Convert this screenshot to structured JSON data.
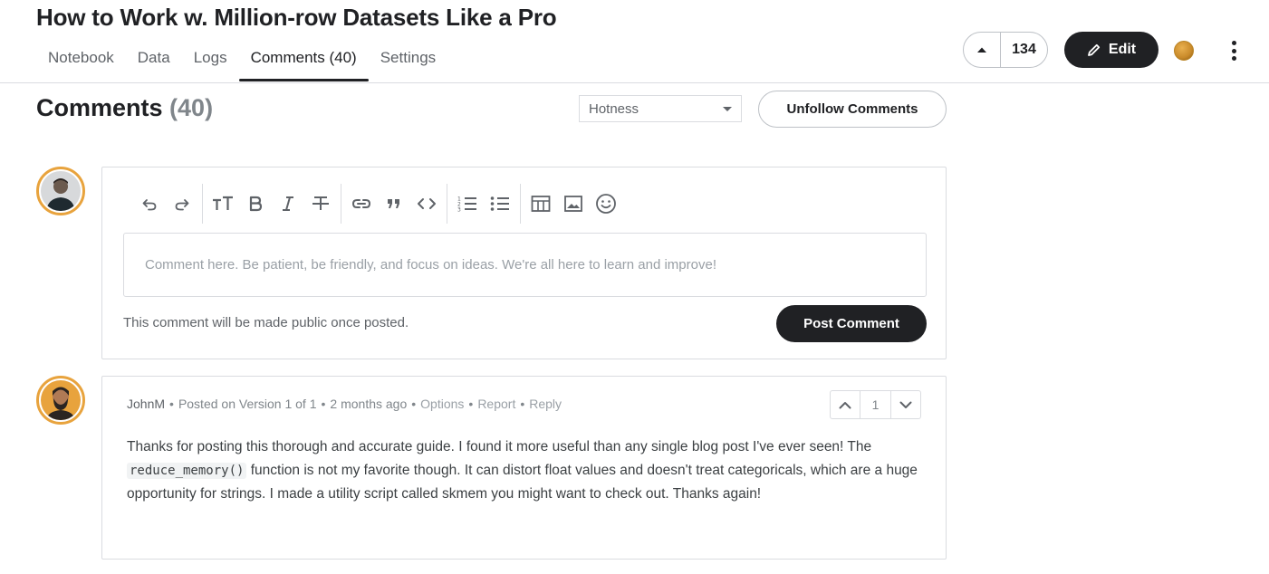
{
  "page": {
    "title": "How to Work w. Million-row Datasets Like a Pro"
  },
  "tabs": [
    {
      "label": "Notebook"
    },
    {
      "label": "Data"
    },
    {
      "label": "Logs"
    },
    {
      "label": "Comments (40)",
      "active": true
    },
    {
      "label": "Settings"
    }
  ],
  "header": {
    "vote_count": "134",
    "edit_label": "Edit"
  },
  "comments_section": {
    "heading": "Comments",
    "count": "(40)",
    "sort_selected": "Hotness",
    "unfollow_label": "Unfollow Comments"
  },
  "editor": {
    "toolbar_icons": [
      "undo-icon",
      "redo-icon",
      "text-size-icon",
      "bold-icon",
      "italic-icon",
      "strikethrough-icon",
      "link-icon",
      "quote-icon",
      "code-icon",
      "ordered-list-icon",
      "bullet-list-icon",
      "table-icon",
      "image-icon",
      "emoji-icon"
    ],
    "placeholder": "Comment here. Be patient, be friendly, and focus on ideas. We're all here to learn and improve!",
    "public_note": "This comment will be made public once posted.",
    "post_label": "Post Comment"
  },
  "comment": {
    "author": "JohnM",
    "posted_on": "Posted on Version 1 of 1",
    "time_ago": "2 months ago",
    "options": "Options",
    "report": "Report",
    "reply": "Reply",
    "votes": "1",
    "body_before_code": "Thanks for posting this thorough and accurate guide. I found it more useful than any single blog post I've ever seen! The ",
    "body_code": "reduce_memory()",
    "body_after_code": " function is not my favorite though. It can distort float values and doesn't treat categoricals, which are a huge opportunity for strings. I made a utility script called skmem you might want to check out. Thanks again!"
  },
  "colors": {
    "primary_dark": "#202124",
    "avatar_ring": "#e8a33d",
    "border": "#dadce0"
  }
}
